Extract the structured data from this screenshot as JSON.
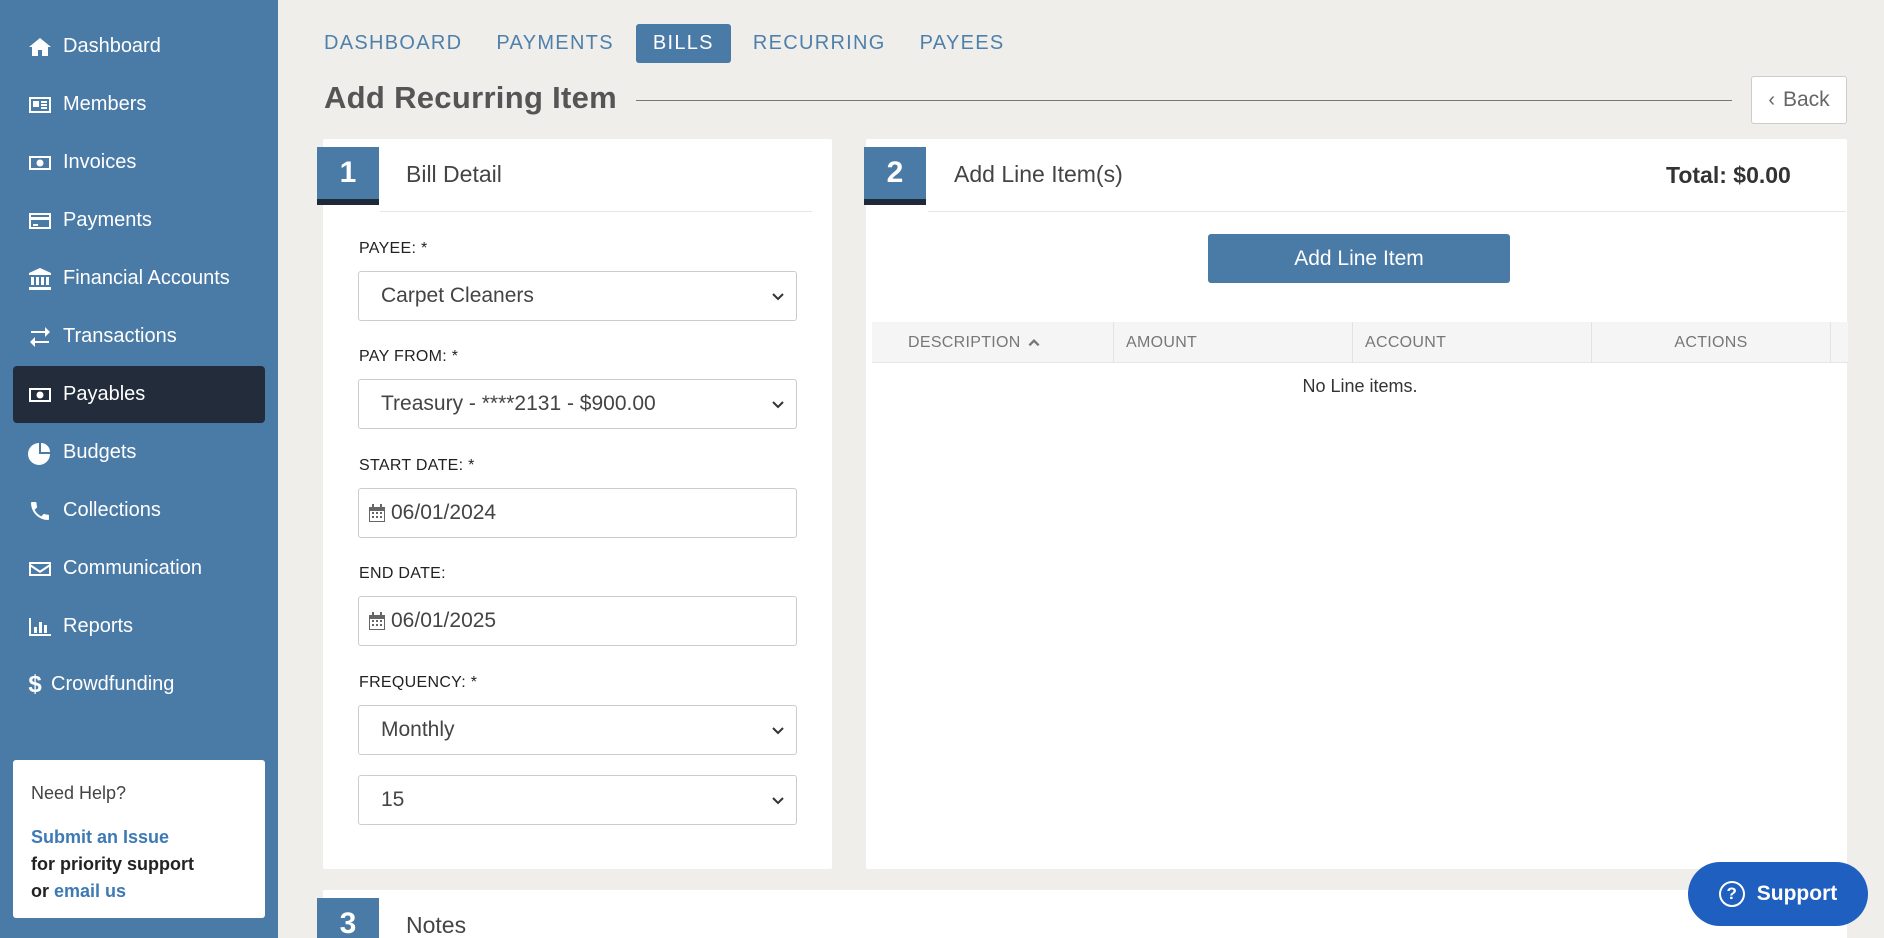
{
  "sidebar": {
    "items": [
      {
        "label": "Dashboard",
        "icon": "home-icon"
      },
      {
        "label": "Members",
        "icon": "id-card-icon"
      },
      {
        "label": "Invoices",
        "icon": "money-icon"
      },
      {
        "label": "Payments",
        "icon": "credit-card-icon"
      },
      {
        "label": "Financial Accounts",
        "icon": "bank-icon"
      },
      {
        "label": "Transactions",
        "icon": "exchange-icon"
      },
      {
        "label": "Payables",
        "icon": "money-icon",
        "active": true
      },
      {
        "label": "Budgets",
        "icon": "pie-chart-icon"
      },
      {
        "label": "Collections",
        "icon": "phone-icon"
      },
      {
        "label": "Communication",
        "icon": "envelope-icon"
      },
      {
        "label": "Reports",
        "icon": "bar-chart-icon"
      },
      {
        "label": "Crowdfunding",
        "icon": "dollar-icon"
      }
    ],
    "help": {
      "title": "Need Help?",
      "submit_link": "Submit an Issue",
      "priority_text": "for priority support",
      "or_text": "or",
      "email_link": "email us"
    }
  },
  "tabs": {
    "items": [
      "DASHBOARD",
      "PAYMENTS",
      "BILLS",
      "RECURRING",
      "PAYEES"
    ],
    "active": "BILLS"
  },
  "page": {
    "title": "Add Recurring Item",
    "back_label": "Back"
  },
  "bill_detail": {
    "step": "1",
    "title": "Bill Detail",
    "payee_label": "PAYEE: *",
    "payee_value": "Carpet Cleaners",
    "pay_from_label": "PAY FROM: *",
    "pay_from_value": "Treasury - ****2131 - $900.00",
    "start_date_label": "START DATE: *",
    "start_date_value": "06/01/2024",
    "end_date_label": "END DATE:",
    "end_date_value": "06/01/2025",
    "frequency_label": "FREQUENCY: *",
    "frequency_value": "Monthly",
    "day_value": "15"
  },
  "line_items": {
    "step": "2",
    "title": "Add Line Item(s)",
    "total": "Total: $0.00",
    "add_button": "Add Line Item",
    "columns": [
      "DESCRIPTION",
      "AMOUNT",
      "ACCOUNT",
      "ACTIONS"
    ],
    "empty_text": "No Line items."
  },
  "notes": {
    "step": "3",
    "title": "Notes"
  },
  "support": {
    "label": "Support",
    "icon_glyph": "?"
  },
  "colors": {
    "sidebar_bg": "#4a7aa6",
    "active_nav": "#232c3a",
    "accent": "#4a7aa6",
    "support_bg": "#1f5fbf"
  }
}
